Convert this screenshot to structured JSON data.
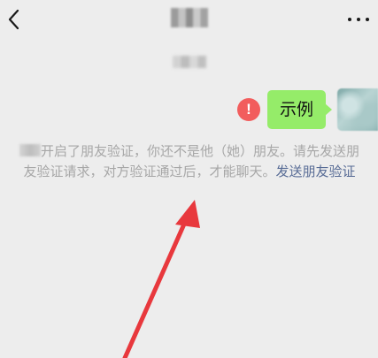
{
  "header": {
    "back_icon": "chevron-left-icon",
    "more_icon": "ellipsis-icon"
  },
  "chat": {
    "message_text": "示例",
    "status_icon_text": "!"
  },
  "notice": {
    "text": "开启了朋友验证，你还不是他（她）朋友。请先发送朋友验证请求，对方验证通过后，才能聊天。",
    "link_text": "发送朋友验证"
  },
  "colors": {
    "background": "#ededed",
    "bubble": "#95ec69",
    "error": "#f25d5d",
    "link": "#576b95",
    "notice_text": "#a7a7a7",
    "arrow": "#e8383d"
  }
}
